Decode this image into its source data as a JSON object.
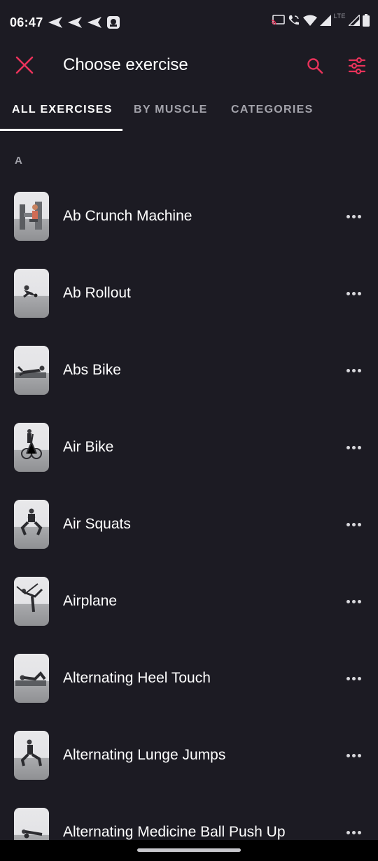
{
  "status_bar": {
    "time": "06:47",
    "network_label": "LTE",
    "roaming_label": "R",
    "notification_icons": [
      "send-icon",
      "send-icon",
      "send-icon",
      "app-icon"
    ],
    "system_icons": [
      "cast-icon",
      "wifi-call-icon",
      "wifi-icon",
      "signal-icon",
      "battery-icon"
    ]
  },
  "header": {
    "title": "Choose exercise",
    "close_icon": "close-icon",
    "search_icon": "search-icon",
    "filter_icon": "filter-sliders-icon",
    "accent_color": "#e8325a"
  },
  "tabs": [
    {
      "label": "ALL EXERCISES",
      "selected": true
    },
    {
      "label": "BY MUSCLE",
      "selected": false
    },
    {
      "label": "CATEGORIES",
      "selected": false
    }
  ],
  "section": {
    "letter": "A"
  },
  "exercises": [
    {
      "name": "Ab Crunch Machine"
    },
    {
      "name": "Ab Rollout"
    },
    {
      "name": "Abs Bike"
    },
    {
      "name": "Air Bike"
    },
    {
      "name": "Air Squats"
    },
    {
      "name": "Airplane"
    },
    {
      "name": "Alternating Heel Touch"
    },
    {
      "name": "Alternating Lunge Jumps"
    },
    {
      "name": "Alternating Medicine Ball Push Up"
    }
  ]
}
